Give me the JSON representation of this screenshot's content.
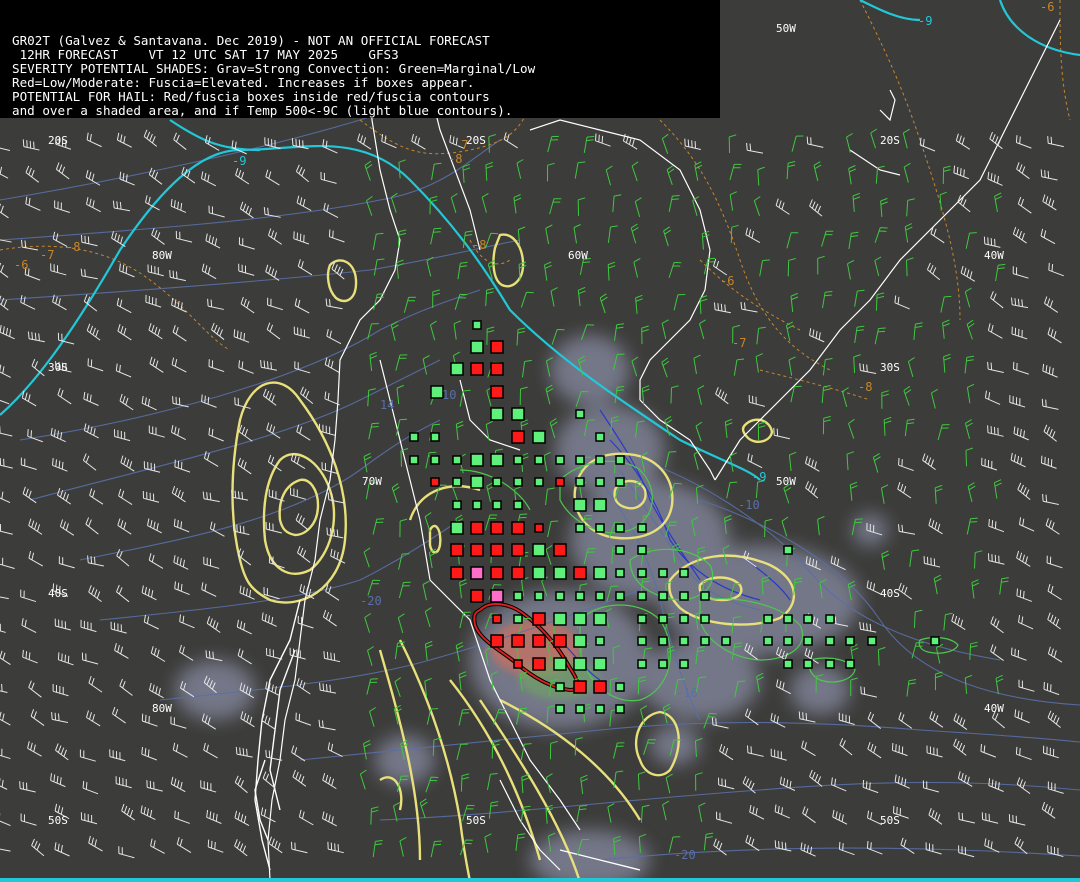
{
  "header": {
    "line1": "GR02T (Galvez & Santavana. Dec 2019) - NOT AN OFFICIAL FORECAST",
    "line2": " 12HR FORECAST    VT 12 UTC SAT 17 MAY 2025    GFS3",
    "line3": "SEVERITY POTENTIAL SHADES: Grav=Strong Convection: Green=Marginal/Low",
    "line4": "Red=Low/Moderate: Fuscia=Elevated. Increases if boxes appear.",
    "line5": "POTENTIAL FOR HAIL: Red/fuscia boxes inside red/fuscia contours",
    "line6": "and over a shaded area, and if Temp 500<-9C (light blue contours)."
  },
  "map_labels": {
    "lat_20s_w": "20S",
    "lat_20s_m": "20S",
    "lat_20s_e": "20S",
    "lat_30s_w": "30S",
    "lat_30s_e": "30S",
    "lat_40s_w": "40S",
    "lat_40s_e": "40S",
    "lat_50s_w": "50S",
    "lat_50s_m": "50S",
    "lat_50s_e": "50S",
    "lon_80w_n": "80W",
    "lon_60w": "60W",
    "lon_40w_n": "40W",
    "lon_50w_top": "50W",
    "lon_50w_mid": "50W",
    "lon_70w": "70W",
    "lon_80w_s": "80W",
    "lon_40w_s": "40W"
  },
  "contour_labels": {
    "t500_a": "-9",
    "t500_b": "-9",
    "t500_c": "-9",
    "temp_a": "-6",
    "temp_b": "-7",
    "temp_c": "-8",
    "temp_d": "-8",
    "temp_e": "-6",
    "temp_f": "-7",
    "temp_g": "-8",
    "temp_h": "-7",
    "temp_i": "-8",
    "temp_j": "-6",
    "blue_a": "-10",
    "blue_b": "-20",
    "blue_c": "-20",
    "blue_d": "-16",
    "blue_e": "14",
    "blue_f": "10"
  },
  "colors": {
    "background": "#3c3c3a",
    "coast": "#ffffff",
    "t500_contour": "#22c8d8",
    "yellow_contour": "#e8e07a",
    "temp_contour": "#c8862a",
    "blue_contour": "#5a6fa8",
    "green_box": "#5ef07a",
    "red_box": "#ff1a1a",
    "fuchsia_box": "#ff6ec8",
    "gray_shade": "#8a8ea6",
    "wind_white": "#e6e6e6",
    "wind_green": "#3fc83f"
  }
}
